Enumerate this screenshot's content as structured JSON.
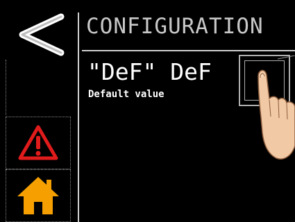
{
  "header": {
    "title": "CONFIGURATION"
  },
  "parameter": {
    "name": "\"DeF\" DeF",
    "description": "Default value"
  },
  "sidebar": {
    "items": [
      {
        "icon": "back-arrow-icon"
      },
      {
        "icon": ""
      },
      {
        "icon": "warning-icon"
      },
      {
        "icon": "home-icon"
      }
    ]
  },
  "colors": {
    "background": "#000000",
    "warning": "#e01b1b",
    "home": "#f5a000",
    "text": "#ffffff",
    "title": "#c8c8c8"
  }
}
